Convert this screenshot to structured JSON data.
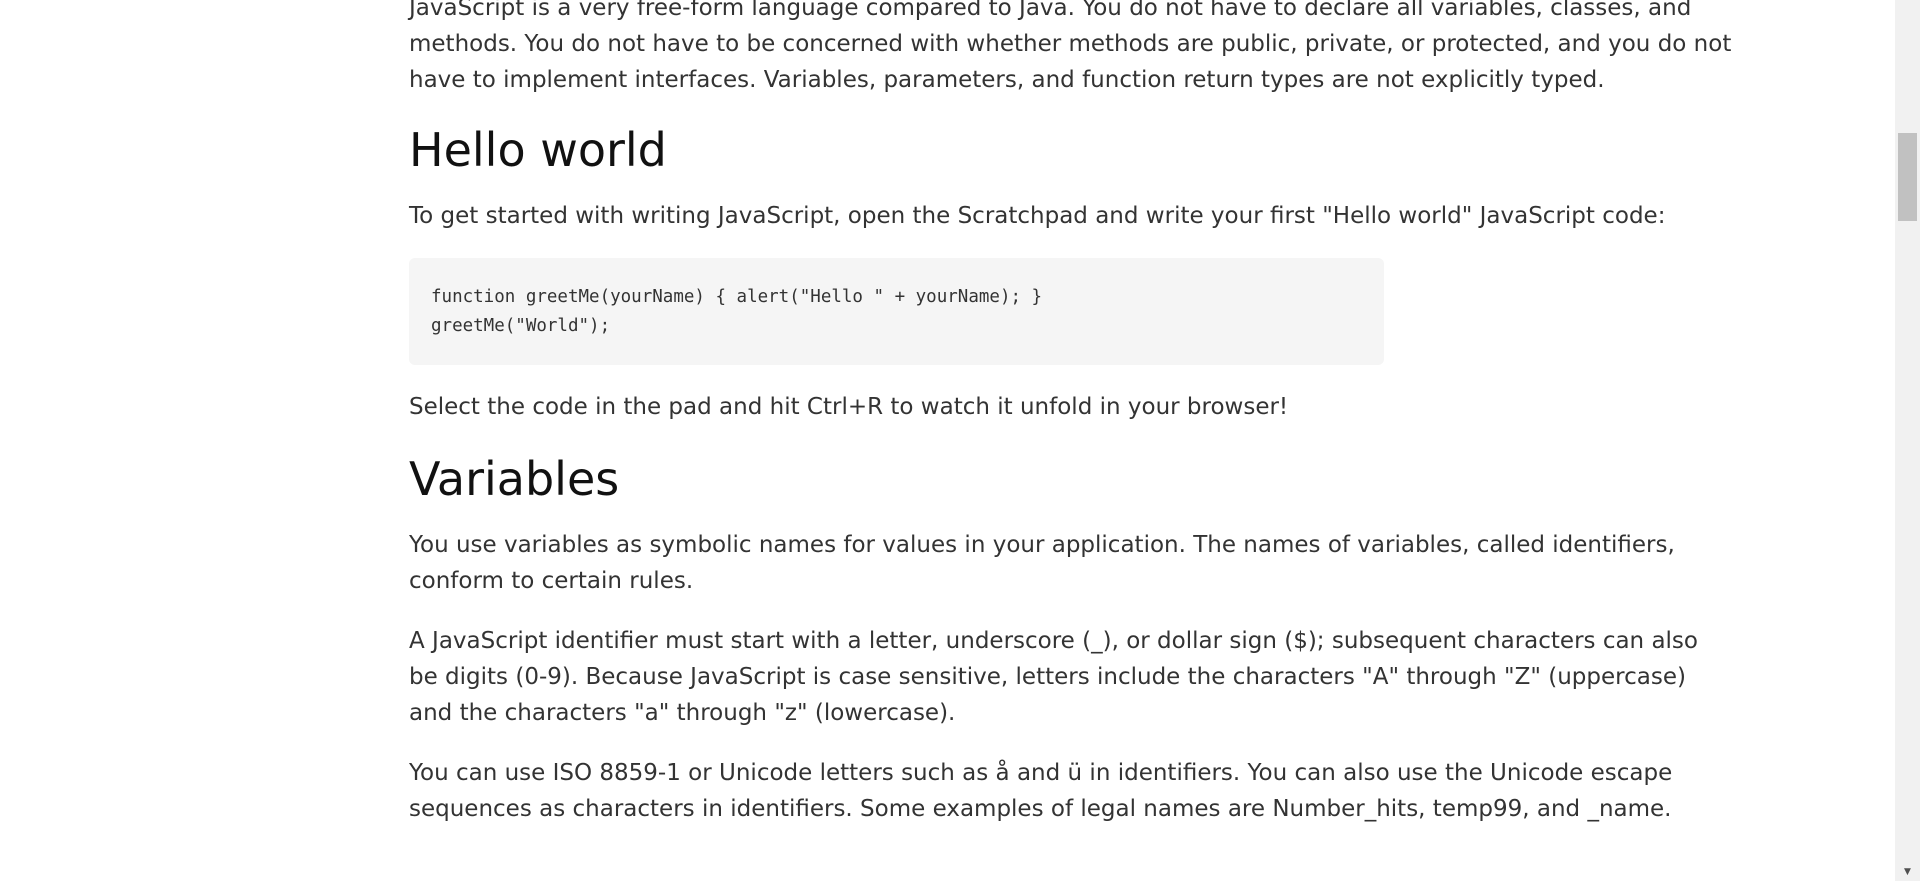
{
  "article": {
    "intro_paragraph": "JavaScript is a very free-form language compared to Java. You do not have to declare all variables, classes, and methods. You do not have to be concerned with whether methods are public, private, or protected, and you do not have to implement interfaces. Variables, parameters, and function return types are not explicitly typed.",
    "hello_world": {
      "heading": "Hello world",
      "paragraph": "To get started with writing JavaScript, open the Scratchpad and write your first \"Hello world\" JavaScript code:",
      "code_lines": [
        "function greetMe(yourName) { alert(\"Hello \" + yourName); }",
        "greetMe(\"World\");"
      ],
      "after_code": "Select the code in the pad and hit Ctrl+R to watch it unfold in your browser!"
    },
    "variables": {
      "heading": "Variables",
      "paragraphs": [
        "You use variables as symbolic names for values in your application. The names of variables, called identifiers, conform to certain rules.",
        "A JavaScript identifier must start with a letter, underscore (_), or dollar sign ($); subsequent characters can also be digits (0-9). Because JavaScript is case sensitive, letters include the characters \"A\" through \"Z\" (uppercase) and the characters \"a\" through \"z\" (lowercase).",
        "You can use ISO 8859-1 or Unicode letters such as å and ü in identifiers. You can also use the Unicode escape sequences as characters in identifiers. Some examples of legal names are Number_hits, temp99, and _name."
      ]
    }
  },
  "scrollbar": {
    "down_arrow_icon": "chevron-down-icon"
  }
}
